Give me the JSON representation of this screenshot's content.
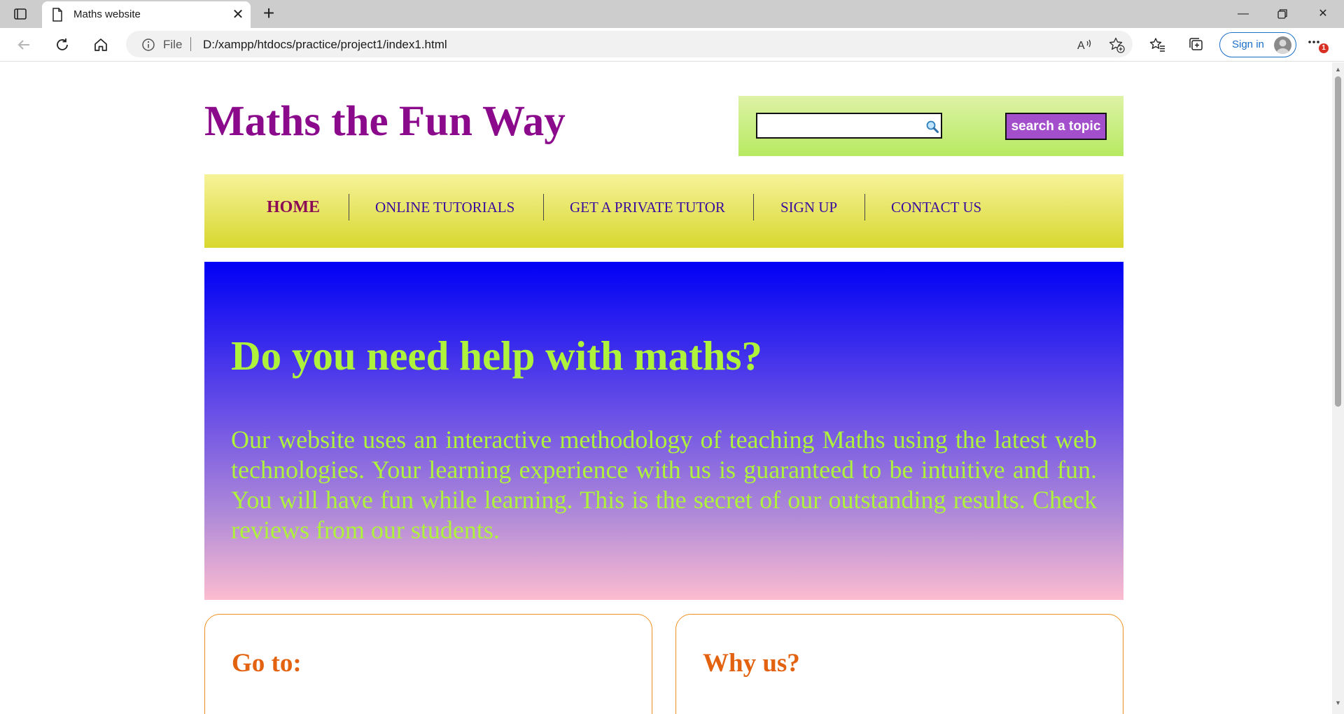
{
  "browser": {
    "tab_title": "Maths website",
    "address_scheme_label": "File",
    "url": "D:/xampp/htdocs/practice/project1/index1.html",
    "signin_label": "Sign in",
    "notification_count": "1"
  },
  "site": {
    "title": "Maths the Fun Way",
    "search": {
      "placeholder": "",
      "button_label": "search a topic"
    },
    "nav": {
      "items": [
        {
          "label": "HOME",
          "active": true
        },
        {
          "label": "ONLINE TUTORIALS",
          "active": false
        },
        {
          "label": "GET A PRIVATE TUTOR",
          "active": false
        },
        {
          "label": "SIGN UP",
          "active": false
        },
        {
          "label": "CONTACT US",
          "active": false
        }
      ]
    },
    "hero": {
      "title": "Do you need help with maths?",
      "text": "Our website uses an interactive methodology of teaching Maths using the latest web technologies. Your learning experience with us is guaranteed to be intuitive and fun. You will have fun while learning. This is the secret of our outstanding results. Check reviews from our students."
    },
    "cards": [
      {
        "title": "Go to:"
      },
      {
        "title": "Why us?"
      }
    ]
  },
  "colors": {
    "site_title": "#8b0a8b",
    "nav_text": "#3c0a9d",
    "hero_text": "#aef23c",
    "card_title": "#e3620f",
    "search_button": "#a34fcc"
  }
}
